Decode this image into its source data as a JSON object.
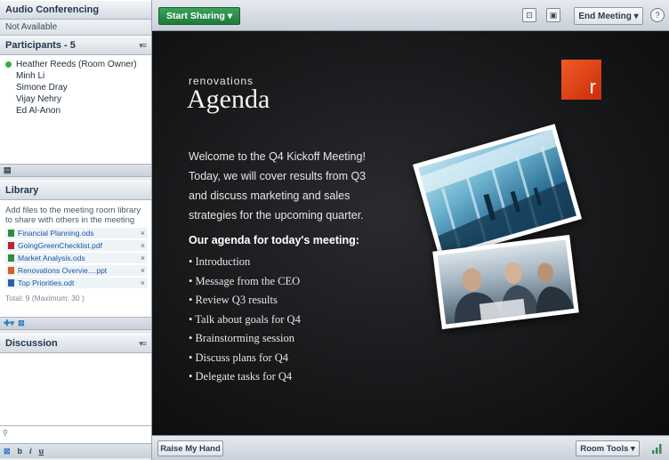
{
  "audio": {
    "title": "Audio Conferencing",
    "status": "Not Available"
  },
  "participants": {
    "title": "Participants - 5",
    "options_icon": "panel-options-icon",
    "list": [
      {
        "name": "Heather Reeds (Room Owner)",
        "status_color": "#3caa4a"
      },
      {
        "name": "Minh Li"
      },
      {
        "name": "Simone Dray"
      },
      {
        "name": "Vijay Nehry"
      },
      {
        "name": "Ed Al-Anon"
      }
    ]
  },
  "library": {
    "title": "Library",
    "description": "Add files to the meeting room library to share with others in the meeting",
    "files": [
      {
        "name": "Financial Planning.ods",
        "icon_color": "#2f8c3a"
      },
      {
        "name": "GoingGreenChecklist.pdf",
        "icon_color": "#c2202a"
      },
      {
        "name": "Market Analysis.ods",
        "icon_color": "#2f8c3a"
      },
      {
        "name": "Renovations Overvie....ppt",
        "icon_color": "#d6601e"
      },
      {
        "name": "Top Priorities.odt",
        "icon_color": "#2a5ea8"
      }
    ],
    "total": "Total: 9 (Maximum: 30 )",
    "remove_glyph": "×"
  },
  "discussion": {
    "title": "Discussion",
    "format": {
      "bold": "b",
      "italic": "i",
      "underline": "u"
    }
  },
  "toolbar": {
    "start_sharing": "Start Sharing ▾",
    "end_meeting": "End Meeting ▾",
    "help": "?"
  },
  "slide": {
    "kicker": "renovations",
    "title": "Agenda",
    "logo_letter": "r",
    "intro": "Welcome to the Q4 Kickoff Meeting! Today, we will cover results from Q3 and discuss marketing and sales strategies for the upcoming quarter.",
    "agenda_heading": "Our agenda for today's meeting:",
    "agenda": [
      "• Introduction",
      "• Message from the CEO",
      "• Review Q3 results",
      "• Talk about goals for Q4",
      "• Brainstorming session",
      "• Discuss plans for Q4",
      "• Delegate tasks for Q4"
    ]
  },
  "bottom": {
    "raise_hand": "Raise My Hand",
    "room_tools": "Room Tools ▾"
  }
}
